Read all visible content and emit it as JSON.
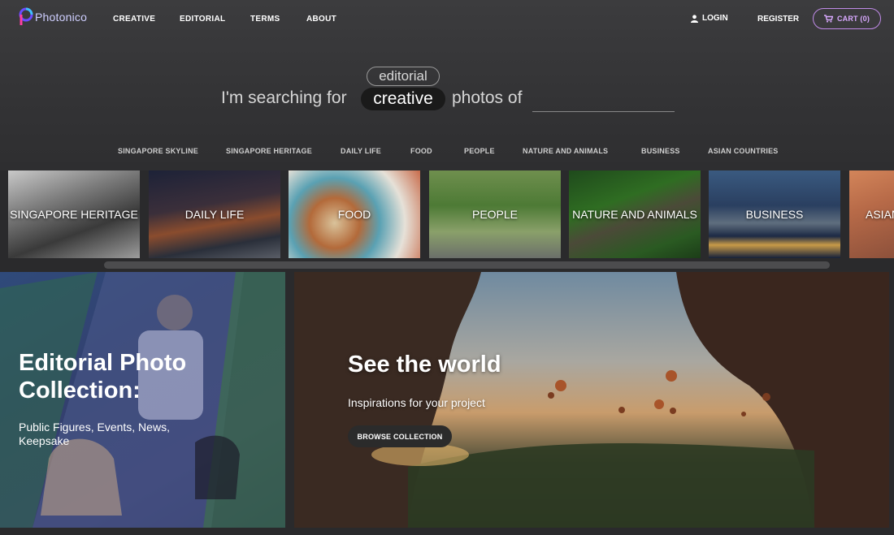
{
  "brand": {
    "name": "Photonico",
    "accent": "#c08be8"
  },
  "nav": {
    "items": [
      "CREATIVE",
      "EDITORIAL",
      "TERMS",
      "ABOUT"
    ]
  },
  "account": {
    "login": "LOGIN",
    "register": "REGISTER",
    "cart": "CART (0)"
  },
  "search": {
    "toggle_alt": "editorial",
    "toggle_active": "creative",
    "prefix": "I'm searching for",
    "suffix": "photos of",
    "placeholder": ""
  },
  "categories": [
    "SINGAPORE SKYLINE",
    "SINGAPORE HERITAGE",
    "DAILY LIFE",
    "FOOD",
    "PEOPLE",
    "NATURE AND ANIMALS",
    "BUSINESS",
    "ASIAN COUNTRIES"
  ],
  "tiles": [
    "SINGAPORE HERITAGE",
    "DAILY LIFE",
    "FOOD",
    "PEOPLE",
    "NATURE AND ANIMALS",
    "BUSINESS",
    "ASIAN"
  ],
  "editorial_panel": {
    "title_line1": "Editorial Photo",
    "title_line2": "Collection:",
    "subtitle": "Public Figures, Events, News, Keepsake"
  },
  "world_panel": {
    "title": "See the world",
    "subtitle": "Inspirations for your project",
    "button": "BROWSE COLLECTION"
  }
}
